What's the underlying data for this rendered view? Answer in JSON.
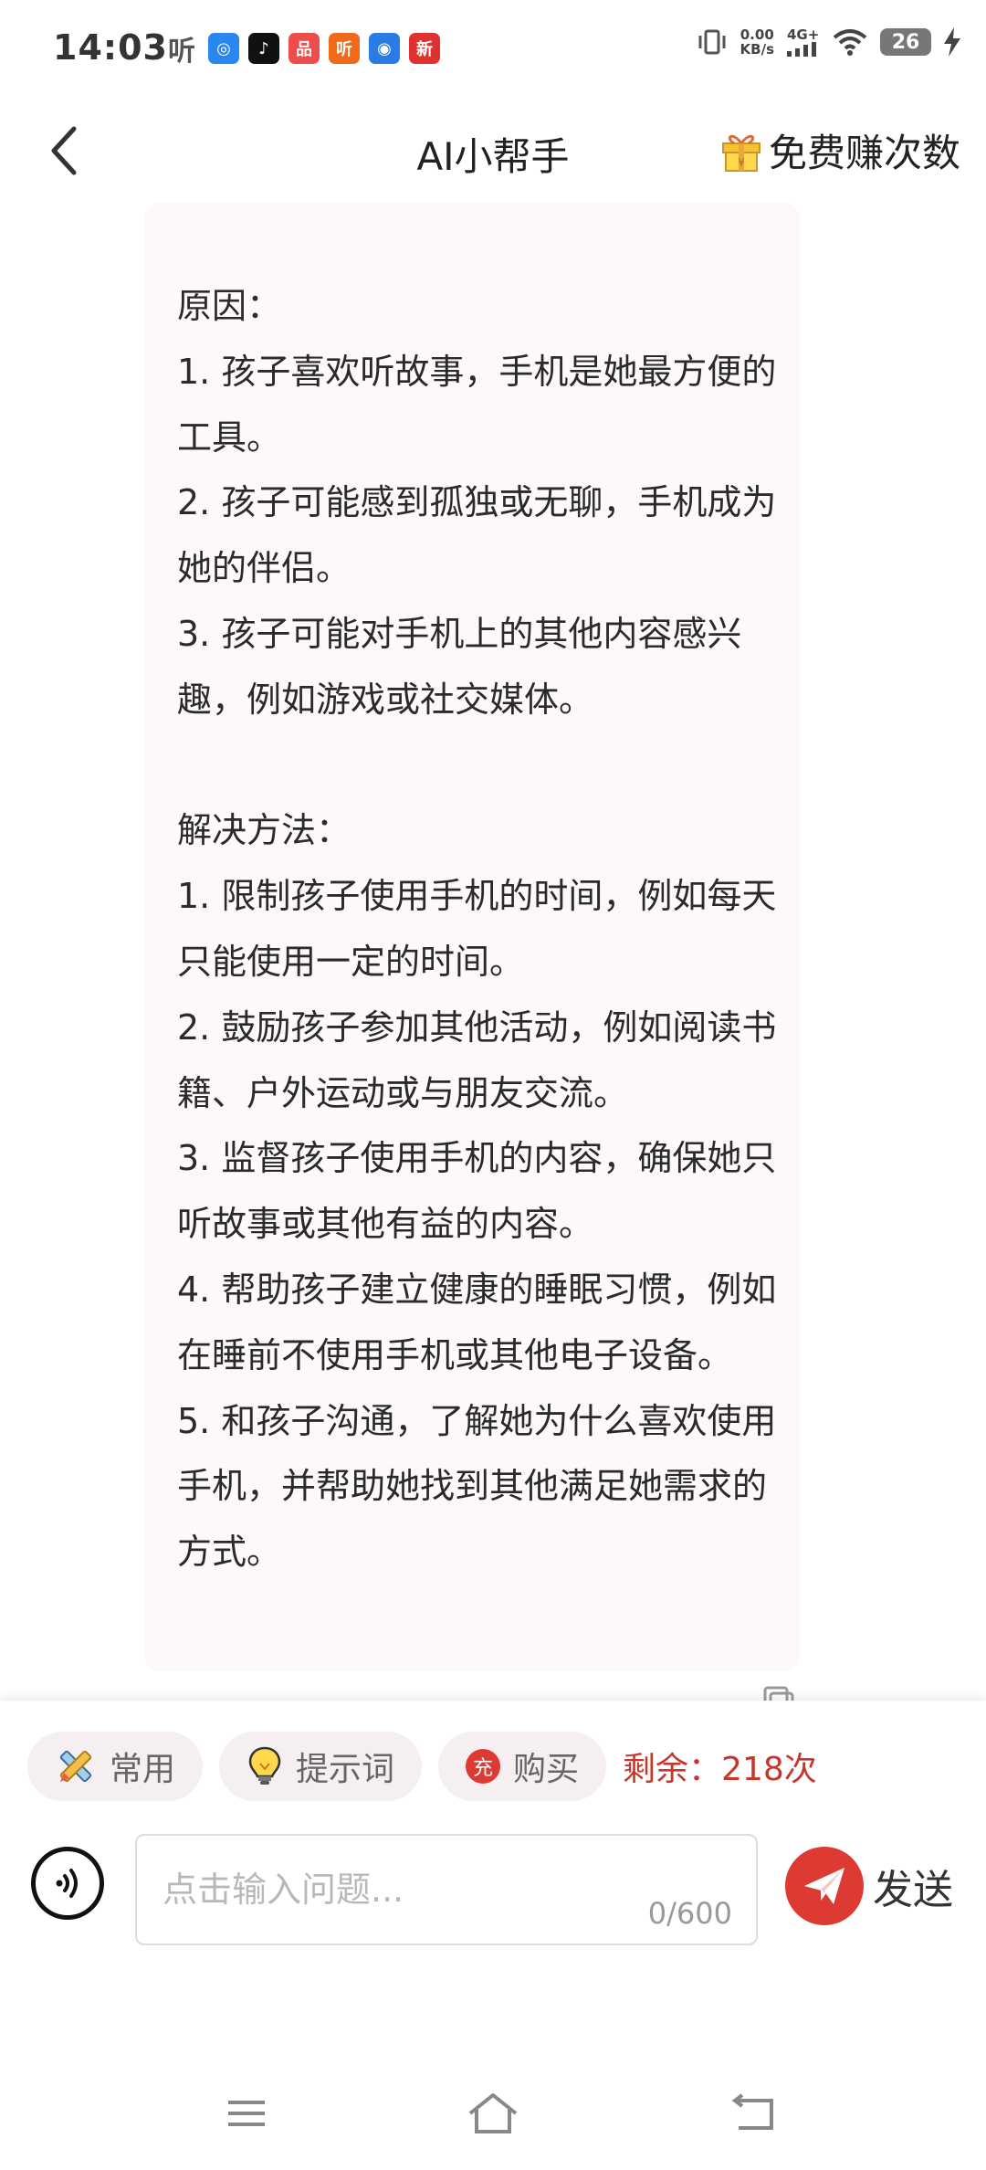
{
  "status_bar": {
    "time": "14:03",
    "app_icons": [
      {
        "name": "ting-icon",
        "text": "听",
        "color": "transparent"
      },
      {
        "name": "messenger-app-icon",
        "text": "◎",
        "color": "#2a86f0"
      },
      {
        "name": "tiktok-app-icon",
        "text": "♪",
        "color": "#111111"
      },
      {
        "name": "xiaohongshu-app-icon",
        "text": "品",
        "color": "#ef4d4d"
      },
      {
        "name": "ting-red-app-icon",
        "text": "听",
        "color": "#f06a1c"
      },
      {
        "name": "fm-app-icon",
        "text": "◉",
        "color": "#2a7be4"
      },
      {
        "name": "news-app-icon",
        "text": "新",
        "color": "#e03131"
      }
    ],
    "net_speed_value": "0.00",
    "net_speed_unit": "KB/s",
    "network_type": "4G+",
    "battery_level": "26"
  },
  "header": {
    "title": "AI小帮手",
    "earn_label": "免费赚次数"
  },
  "message": {
    "text": "原因：\n1. 孩子喜欢听故事，手机是她最方便的工具。\n2. 孩子可能感到孤独或无聊，手机成为她的伴侣。\n3. 孩子可能对手机上的其他内容感兴趣，例如游戏或社交媒体。\n\n解决方法：\n1. 限制孩子使用手机的时间，例如每天只能使用一定的时间。\n2. 鼓励孩子参加其他活动，例如阅读书籍、户外运动或与朋友交流。\n3. 监督孩子使用手机的内容，确保她只听故事或其他有益的内容。\n4. 帮助孩子建立健康的睡眠习惯，例如在睡前不使用手机或其他电子设备。\n5. 和孩子沟通，了解她为什么喜欢使用手机，并帮助她找到其他满足她需求的方式。"
  },
  "toolbar": {
    "common_label": "常用",
    "prompt_label": "提示词",
    "buy_badge": "充",
    "buy_label": "购买",
    "remaining_label": "剩余：218次"
  },
  "input": {
    "placeholder": "点击输入问题...",
    "counter": "0/600",
    "send_label": "发送"
  },
  "colors": {
    "accent_red": "#dd3a33",
    "remaining_red": "#c8352a",
    "bubble_bg": "#fcf8fb",
    "chip_bg": "#f5eff2"
  }
}
